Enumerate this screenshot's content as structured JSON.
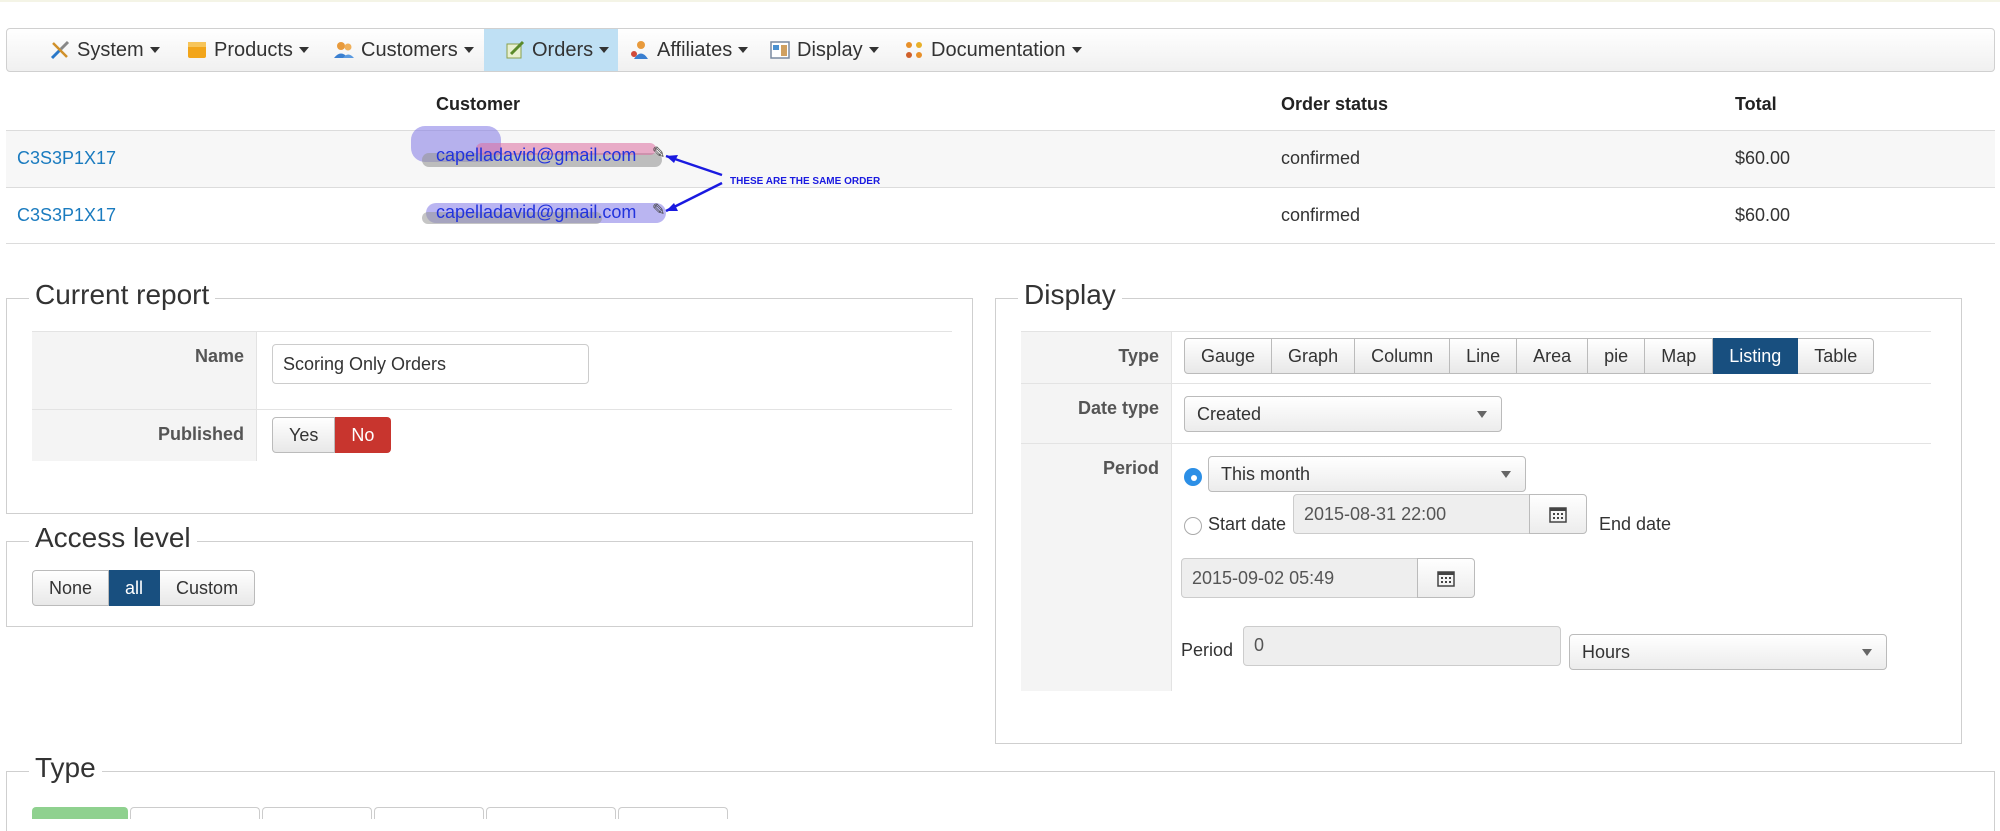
{
  "menu": [
    {
      "label": "System",
      "icon": "tools-icon"
    },
    {
      "label": "Products",
      "icon": "box-icon"
    },
    {
      "label": "Customers",
      "icon": "users-icon"
    },
    {
      "label": "Orders",
      "icon": "orders-icon",
      "active": true
    },
    {
      "label": "Affiliates",
      "icon": "affiliates-icon"
    },
    {
      "label": "Display",
      "icon": "display-icon"
    },
    {
      "label": "Documentation",
      "icon": "documentation-icon"
    }
  ],
  "orders_table": {
    "headers": {
      "customer": "Customer",
      "status": "Order status",
      "total": "Total"
    },
    "rows": [
      {
        "order": "C3S3P1X17",
        "email": "capelladavid@gmail.com",
        "status": "confirmed",
        "total": "$60.00"
      },
      {
        "order": "C3S3P1X17",
        "email": "capelladavid@gmail.com",
        "status": "confirmed",
        "total": "$60.00"
      }
    ],
    "annotation": "THESE ARE THE SAME ORDER"
  },
  "current_report": {
    "legend": "Current report",
    "name_label": "Name",
    "name_value": "Scoring Only Orders",
    "published_label": "Published",
    "published_options": [
      "Yes",
      "No"
    ],
    "published_selected": "No"
  },
  "access_level": {
    "legend": "Access level",
    "options": [
      "None",
      "all",
      "Custom"
    ],
    "selected": "all"
  },
  "display": {
    "legend": "Display",
    "type_label": "Type",
    "type_options": [
      "Gauge",
      "Graph",
      "Column",
      "Line",
      "Area",
      "pie",
      "Map",
      "Listing",
      "Table"
    ],
    "type_selected": "Listing",
    "date_type_label": "Date type",
    "date_type_value": "Created",
    "period_label": "Period",
    "period_select_value": "This month",
    "start_date_label": "Start date",
    "start_date_value": "2015-08-31 22:00",
    "end_date_label": "End date",
    "end_date_value": "2015-09-02 05:49",
    "period_value_label": "Period",
    "period_value": "0",
    "period_unit": "Hours"
  },
  "type_section": {
    "legend": "Type"
  },
  "colors": {
    "active_blue": "#184f7f",
    "active_red": "#c8352e",
    "link": "#1a7bbf",
    "menu_active": "#bfe0f4"
  }
}
